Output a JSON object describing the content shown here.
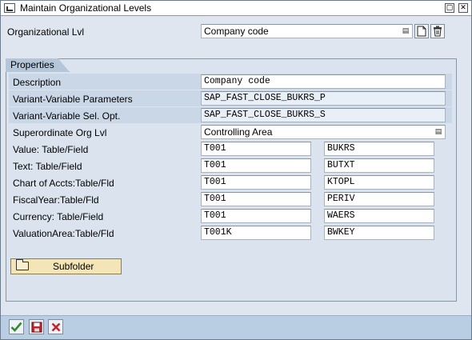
{
  "window": {
    "title": "Maintain Organizational Levels",
    "close_glyph": "✕"
  },
  "header": {
    "org_level_label": "Organizational Lvl",
    "org_level_value": "Company code"
  },
  "properties": {
    "tab_label": "Properties",
    "description_label": "Description",
    "description_value": "Company code",
    "variant_params_label": "Variant-Variable Parameters",
    "variant_params_value": "SAP_FAST_CLOSE_BUKRS_P",
    "variant_sel_label": "Variant-Variable Sel. Opt.",
    "variant_sel_value": "SAP_FAST_CLOSE_BUKRS_S",
    "superordinate_label": "Superordinate Org Lvl",
    "superordinate_value": "Controlling Area",
    "table_rows": [
      {
        "label": "Value: Table/Field",
        "table": "T001",
        "field": "BUKRS"
      },
      {
        "label": "Text: Table/Field",
        "table": "T001",
        "field": "BUTXT"
      },
      {
        "label": "Chart of Accts:Table/Fld",
        "table": "T001",
        "field": "KTOPL"
      },
      {
        "label": "FiscalYear:Table/Fld",
        "table": "T001",
        "field": "PERIV"
      },
      {
        "label": "Currency: Table/Field",
        "table": "T001",
        "field": "WAERS"
      },
      {
        "label": "ValuationArea:Table/Fld",
        "table": "T001K",
        "field": "BWKEY"
      }
    ],
    "subfolder_label": "Subfolder"
  },
  "footer": {
    "buttons": [
      "check-icon",
      "save-icon",
      "cancel-icon"
    ]
  },
  "colors": {
    "footer_bg": "#b9cde3",
    "tab_bg": "#b4c6da",
    "check": "#2e8b2e",
    "cancel": "#c0262d"
  }
}
